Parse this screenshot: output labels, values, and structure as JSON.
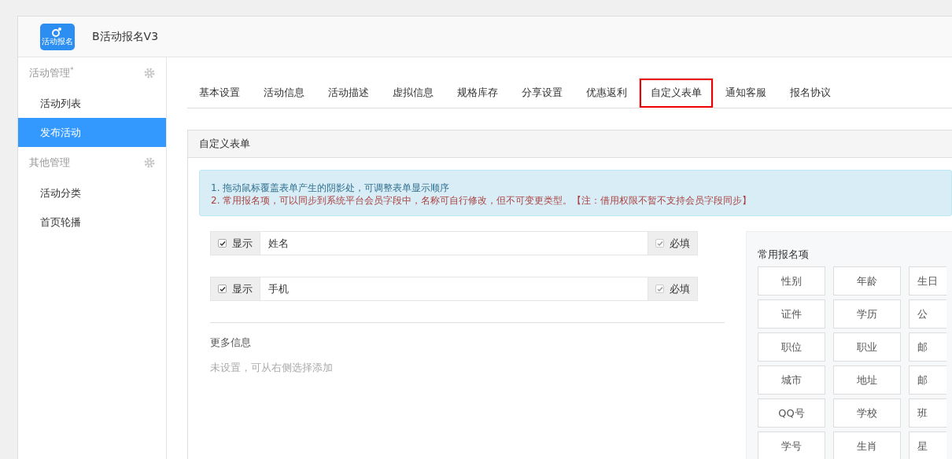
{
  "app": {
    "logo_text": "活动报名",
    "title": "B活动报名V3"
  },
  "sidebar": [
    {
      "group": "活动管理",
      "mark": "*",
      "items": [
        {
          "label": "活动列表",
          "selected": false
        },
        {
          "label": "发布活动",
          "selected": true
        }
      ]
    },
    {
      "group": "其他管理",
      "items": [
        {
          "label": "活动分类",
          "selected": false
        },
        {
          "label": "首页轮播",
          "selected": false
        }
      ]
    }
  ],
  "tabs": [
    {
      "label": "基本设置",
      "selected": false,
      "highlighted": false
    },
    {
      "label": "活动信息",
      "selected": false,
      "highlighted": false
    },
    {
      "label": "活动描述",
      "selected": false,
      "highlighted": false
    },
    {
      "label": "虚拟信息",
      "selected": false,
      "highlighted": false
    },
    {
      "label": "规格库存",
      "selected": false,
      "highlighted": false
    },
    {
      "label": "分享设置",
      "selected": false,
      "highlighted": false
    },
    {
      "label": "优惠返利",
      "selected": false,
      "highlighted": false
    },
    {
      "label": "自定义表单",
      "selected": true,
      "highlighted": true
    },
    {
      "label": "通知客服",
      "selected": false,
      "highlighted": false
    },
    {
      "label": "报名协议",
      "selected": false,
      "highlighted": false
    }
  ],
  "panel": {
    "title": "自定义表单",
    "notes": [
      {
        "text": "1. 拖动鼠标覆盖表单产生的阴影处，可调整表单显示顺序",
        "kind": "info"
      },
      {
        "text": "2. 常用报名项，可以同步到系统平台会员字段中，名称可自行修改，但不可变更类型。【注：借用权限不暂不支持会员字段同步】",
        "kind": "warning"
      }
    ],
    "fields": [
      {
        "show_label": "显示",
        "show_checked": true,
        "value": "姓名",
        "required_label": "必填",
        "required_checked": true
      },
      {
        "show_label": "显示",
        "show_checked": true,
        "value": "手机",
        "required_label": "必填",
        "required_checked": true
      }
    ],
    "more_title": "更多信息",
    "more_empty": "未设置，可从右侧选择添加",
    "common": {
      "title": "常用报名项",
      "items": [
        "性别",
        "年龄",
        "生日",
        "证件",
        "学历",
        "公",
        "职位",
        "职业",
        "邮",
        "城市",
        "地址",
        "邮",
        "QQ号",
        "学校",
        "班",
        "学号",
        "生肖",
        "星"
      ]
    }
  }
}
